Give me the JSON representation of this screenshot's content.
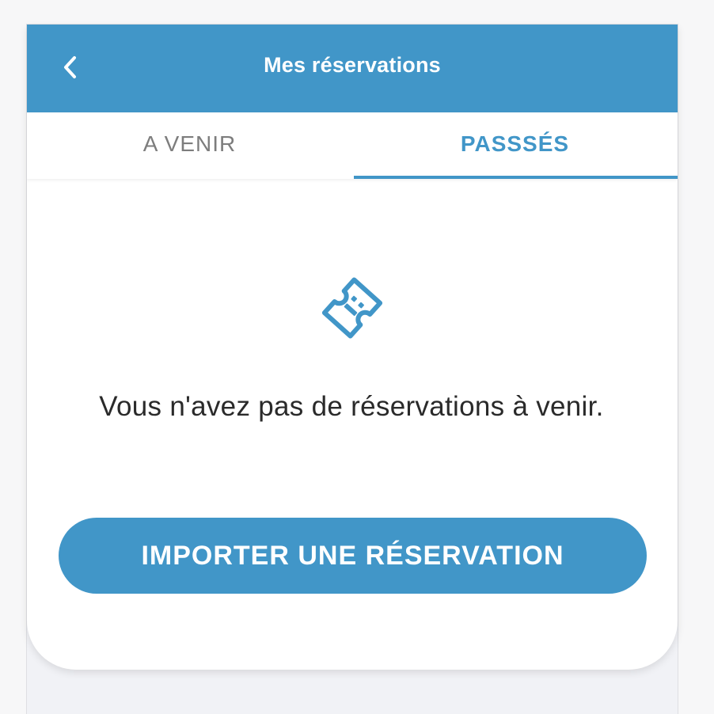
{
  "header": {
    "title": "Mes réservations",
    "back_icon": "chevron-left-icon"
  },
  "tabs": [
    {
      "label": "A VENIR",
      "selected": false
    },
    {
      "label": "PASSSÉS",
      "selected": true
    }
  ],
  "empty_state": {
    "icon": "ticket-icon",
    "message": "Vous n'avez pas de réservations à venir."
  },
  "import_button": {
    "label": "IMPORTER UNE RÉSERVATION"
  },
  "colors": {
    "accent": "#4196c8",
    "tab_inactive": "#7d7d7d",
    "text_dark": "#2a2a2a",
    "background": "#f1f2f6"
  }
}
